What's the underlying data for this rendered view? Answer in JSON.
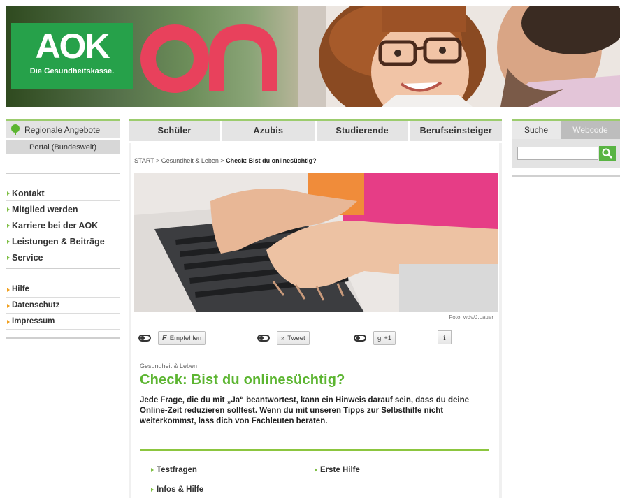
{
  "header": {
    "logo": {
      "text": "AOK",
      "tagline": "Die Gesundheitskasse."
    },
    "brand_mark": "on",
    "colors": {
      "logo_green": "#26a14a",
      "on_pink": "#e8415c",
      "accent_green": "#8cc63f"
    }
  },
  "sidebar": {
    "region_label": "Regionale Angebote",
    "portal_label": "Portal (Bundesweit)",
    "nav_main": [
      {
        "label": "Kontakt"
      },
      {
        "label": "Mitglied werden"
      },
      {
        "label": "Karriere bei der AOK"
      },
      {
        "label": "Leistungen & Beiträge"
      },
      {
        "label": "Service"
      }
    ],
    "nav_secondary": [
      {
        "label": "Hilfe"
      },
      {
        "label": "Datenschutz"
      },
      {
        "label": "Impressum"
      }
    ]
  },
  "tabs": [
    {
      "label": "Schüler"
    },
    {
      "label": "Azubis"
    },
    {
      "label": "Studierende"
    },
    {
      "label": "Berufseinsteiger"
    }
  ],
  "breadcrumb": {
    "start": "START",
    "sep1": " > ",
    "section": "Gesundheit & Leben",
    "sep2": " > ",
    "current": "Check: Bist du onlinesüchtig?"
  },
  "hero": {
    "credit": "Foto: wdv/J.Lauer",
    "icon": "laptop-typing-photo"
  },
  "share": {
    "facebook_label": "Empfehlen",
    "twitter_label": "Tweet",
    "gplus_label": "+1",
    "info_label": "i"
  },
  "article": {
    "kicker": "Gesundheit & Leben",
    "title": "Check: Bist du onlinesüchtig?",
    "lead": "Jede Frage, die du mit „Ja“ beantwortest, kann ein Hinweis darauf sein, dass du deine Online-Zeit reduzieren solltest. Wenn du mit unseren Tipps zur Selbsthilfe nicht weiterkommst, lass dich von Fachleuten beraten.",
    "links": [
      {
        "label": "Testfragen"
      },
      {
        "label": "Erste Hilfe"
      },
      {
        "label": "Infos & Hilfe"
      }
    ]
  },
  "search": {
    "tab_search": "Suche",
    "tab_webcode": "Webcode",
    "placeholder": "",
    "button_icon": "search-icon"
  }
}
